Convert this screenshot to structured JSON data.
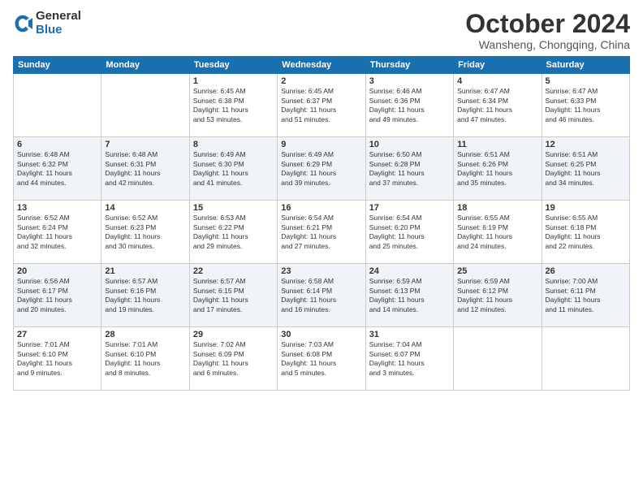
{
  "logo": {
    "general": "General",
    "blue": "Blue"
  },
  "header": {
    "month": "October 2024",
    "location": "Wansheng, Chongqing, China"
  },
  "weekdays": [
    "Sunday",
    "Monday",
    "Tuesday",
    "Wednesday",
    "Thursday",
    "Friday",
    "Saturday"
  ],
  "weeks": [
    [
      {
        "day": "",
        "info": ""
      },
      {
        "day": "",
        "info": ""
      },
      {
        "day": "1",
        "info": "Sunrise: 6:45 AM\nSunset: 6:38 PM\nDaylight: 11 hours\nand 53 minutes."
      },
      {
        "day": "2",
        "info": "Sunrise: 6:45 AM\nSunset: 6:37 PM\nDaylight: 11 hours\nand 51 minutes."
      },
      {
        "day": "3",
        "info": "Sunrise: 6:46 AM\nSunset: 6:36 PM\nDaylight: 11 hours\nand 49 minutes."
      },
      {
        "day": "4",
        "info": "Sunrise: 6:47 AM\nSunset: 6:34 PM\nDaylight: 11 hours\nand 47 minutes."
      },
      {
        "day": "5",
        "info": "Sunrise: 6:47 AM\nSunset: 6:33 PM\nDaylight: 11 hours\nand 46 minutes."
      }
    ],
    [
      {
        "day": "6",
        "info": "Sunrise: 6:48 AM\nSunset: 6:32 PM\nDaylight: 11 hours\nand 44 minutes."
      },
      {
        "day": "7",
        "info": "Sunrise: 6:48 AM\nSunset: 6:31 PM\nDaylight: 11 hours\nand 42 minutes."
      },
      {
        "day": "8",
        "info": "Sunrise: 6:49 AM\nSunset: 6:30 PM\nDaylight: 11 hours\nand 41 minutes."
      },
      {
        "day": "9",
        "info": "Sunrise: 6:49 AM\nSunset: 6:29 PM\nDaylight: 11 hours\nand 39 minutes."
      },
      {
        "day": "10",
        "info": "Sunrise: 6:50 AM\nSunset: 6:28 PM\nDaylight: 11 hours\nand 37 minutes."
      },
      {
        "day": "11",
        "info": "Sunrise: 6:51 AM\nSunset: 6:26 PM\nDaylight: 11 hours\nand 35 minutes."
      },
      {
        "day": "12",
        "info": "Sunrise: 6:51 AM\nSunset: 6:25 PM\nDaylight: 11 hours\nand 34 minutes."
      }
    ],
    [
      {
        "day": "13",
        "info": "Sunrise: 6:52 AM\nSunset: 6:24 PM\nDaylight: 11 hours\nand 32 minutes."
      },
      {
        "day": "14",
        "info": "Sunrise: 6:52 AM\nSunset: 6:23 PM\nDaylight: 11 hours\nand 30 minutes."
      },
      {
        "day": "15",
        "info": "Sunrise: 6:53 AM\nSunset: 6:22 PM\nDaylight: 11 hours\nand 29 minutes."
      },
      {
        "day": "16",
        "info": "Sunrise: 6:54 AM\nSunset: 6:21 PM\nDaylight: 11 hours\nand 27 minutes."
      },
      {
        "day": "17",
        "info": "Sunrise: 6:54 AM\nSunset: 6:20 PM\nDaylight: 11 hours\nand 25 minutes."
      },
      {
        "day": "18",
        "info": "Sunrise: 6:55 AM\nSunset: 6:19 PM\nDaylight: 11 hours\nand 24 minutes."
      },
      {
        "day": "19",
        "info": "Sunrise: 6:55 AM\nSunset: 6:18 PM\nDaylight: 11 hours\nand 22 minutes."
      }
    ],
    [
      {
        "day": "20",
        "info": "Sunrise: 6:56 AM\nSunset: 6:17 PM\nDaylight: 11 hours\nand 20 minutes."
      },
      {
        "day": "21",
        "info": "Sunrise: 6:57 AM\nSunset: 6:16 PM\nDaylight: 11 hours\nand 19 minutes."
      },
      {
        "day": "22",
        "info": "Sunrise: 6:57 AM\nSunset: 6:15 PM\nDaylight: 11 hours\nand 17 minutes."
      },
      {
        "day": "23",
        "info": "Sunrise: 6:58 AM\nSunset: 6:14 PM\nDaylight: 11 hours\nand 16 minutes."
      },
      {
        "day": "24",
        "info": "Sunrise: 6:59 AM\nSunset: 6:13 PM\nDaylight: 11 hours\nand 14 minutes."
      },
      {
        "day": "25",
        "info": "Sunrise: 6:59 AM\nSunset: 6:12 PM\nDaylight: 11 hours\nand 12 minutes."
      },
      {
        "day": "26",
        "info": "Sunrise: 7:00 AM\nSunset: 6:11 PM\nDaylight: 11 hours\nand 11 minutes."
      }
    ],
    [
      {
        "day": "27",
        "info": "Sunrise: 7:01 AM\nSunset: 6:10 PM\nDaylight: 11 hours\nand 9 minutes."
      },
      {
        "day": "28",
        "info": "Sunrise: 7:01 AM\nSunset: 6:10 PM\nDaylight: 11 hours\nand 8 minutes."
      },
      {
        "day": "29",
        "info": "Sunrise: 7:02 AM\nSunset: 6:09 PM\nDaylight: 11 hours\nand 6 minutes."
      },
      {
        "day": "30",
        "info": "Sunrise: 7:03 AM\nSunset: 6:08 PM\nDaylight: 11 hours\nand 5 minutes."
      },
      {
        "day": "31",
        "info": "Sunrise: 7:04 AM\nSunset: 6:07 PM\nDaylight: 11 hours\nand 3 minutes."
      },
      {
        "day": "",
        "info": ""
      },
      {
        "day": "",
        "info": ""
      }
    ]
  ]
}
